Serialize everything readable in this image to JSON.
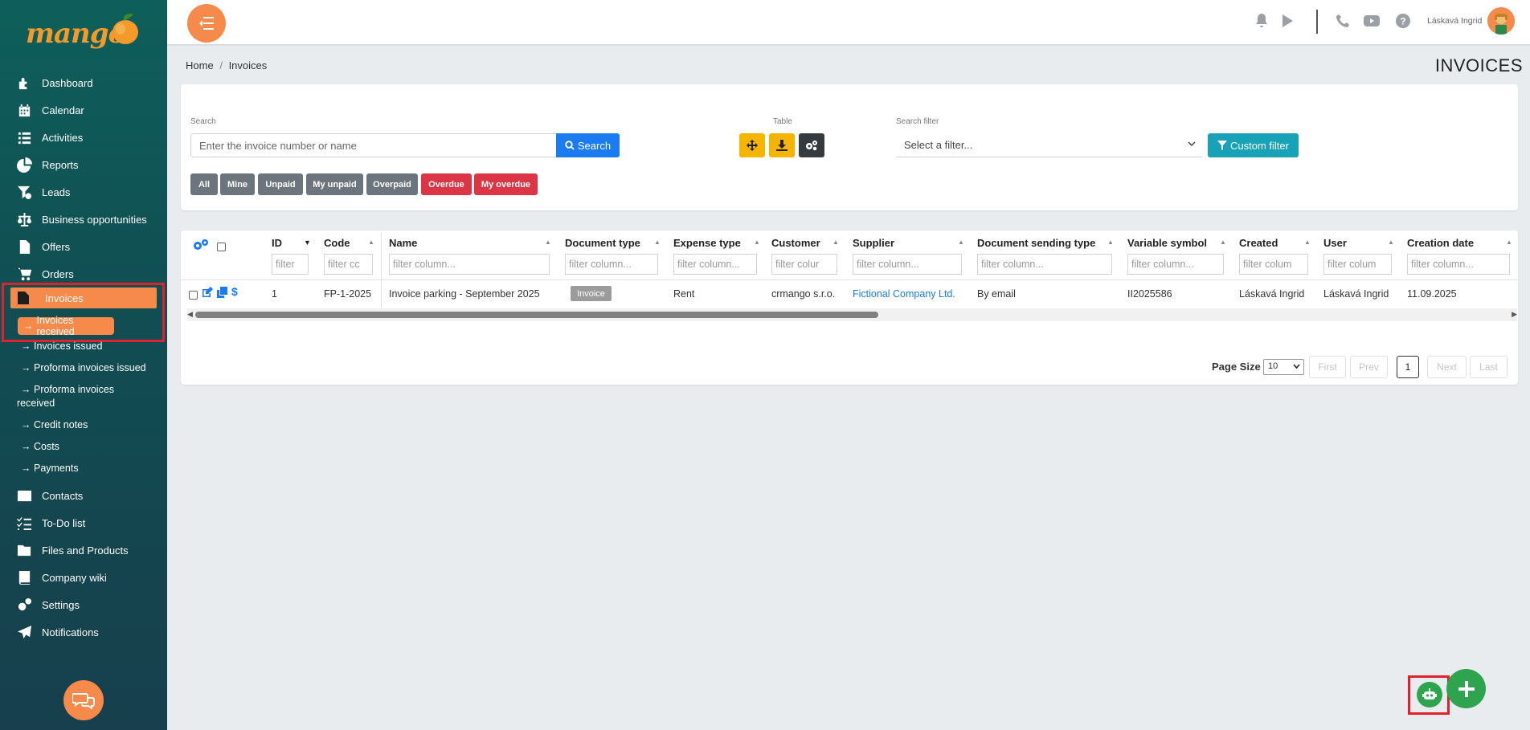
{
  "app": {
    "logo_text": "mango"
  },
  "sidebar": {
    "items": [
      {
        "label": "Dashboard",
        "icon": "puzzle-icon"
      },
      {
        "label": "Calendar",
        "icon": "calendar-icon"
      },
      {
        "label": "Activities",
        "icon": "list-icon"
      },
      {
        "label": "Reports",
        "icon": "pie-chart-icon"
      },
      {
        "label": "Leads",
        "icon": "funnel-dollar-icon"
      },
      {
        "label": "Business opportunities",
        "icon": "scales-icon"
      },
      {
        "label": "Offers",
        "icon": "file-icon"
      },
      {
        "label": "Orders",
        "icon": "cart-icon"
      }
    ],
    "invoices": {
      "label": "Invoices",
      "icon": "invoice-icon"
    },
    "sub_items": [
      {
        "label": "Invoices received",
        "active": true
      },
      {
        "label": "Invoices issued"
      },
      {
        "label": "Proforma invoices issued"
      },
      {
        "label": "Proforma invoices",
        "label2": "received"
      },
      {
        "label": "Credit notes"
      },
      {
        "label": "Costs"
      },
      {
        "label": "Payments"
      }
    ],
    "bottom_items": [
      {
        "label": "Contacts",
        "icon": "id-card-icon"
      },
      {
        "label": "To-Do list",
        "icon": "checklist-icon"
      },
      {
        "label": "Files and Products",
        "icon": "folder-icon"
      },
      {
        "label": "Company wiki",
        "icon": "book-icon"
      },
      {
        "label": "Settings",
        "icon": "gears-icon"
      },
      {
        "label": "Notifications",
        "icon": "paper-plane-icon"
      }
    ]
  },
  "topbar": {
    "username": "Láskavá Ingrid"
  },
  "breadcrumb": {
    "home": "Home",
    "separator": "/",
    "current": "Invoices"
  },
  "page_title": "INVOICES",
  "search": {
    "label": "Search",
    "placeholder": "Enter the invoice number or name",
    "button": "Search",
    "table_label": "Table",
    "filter_label": "Search filter",
    "filter_value": "Select a filter...",
    "custom_filter_button": "Custom filter"
  },
  "quick_filters": [
    "All",
    "Mine",
    "Unpaid",
    "My unpaid",
    "Overpaid",
    "Overdue",
    "My overdue"
  ],
  "table": {
    "columns": [
      "ID",
      "Code",
      "Name",
      "Document type",
      "Expense type",
      "Customer",
      "Supplier",
      "Document sending type",
      "Variable symbol",
      "Created",
      "User",
      "Creation date"
    ],
    "filter_placeholders": [
      "filter",
      "filter cc",
      "filter column...",
      "filter column...",
      "filter column...",
      "filter colur",
      "filter column...",
      "filter column...",
      "filter column...",
      "filter colum",
      "filter colum",
      "filter column..."
    ],
    "rows": [
      {
        "id": "1",
        "code": "FP-1-2025",
        "name": "Invoice parking - September 2025",
        "document_type": "Invoice",
        "expense_type": "Rent",
        "customer": "crmango s.r.o.",
        "supplier": "Fictional Company Ltd.",
        "sending_type": "By email",
        "variable_symbol": "II2025586",
        "created": "Láskavá Ingrid",
        "user": "Láskavá Ingrid",
        "creation_date": "11.09.2025"
      }
    ]
  },
  "pagination": {
    "page_size_label": "Page Size",
    "page_size": "10",
    "first": "First",
    "prev": "Prev",
    "current": "1",
    "next": "Next",
    "last": "Last"
  },
  "colors": {
    "accent": "#f58a4b",
    "sidebar": "#0e5f5b",
    "primary": "#1a7cf0",
    "info": "#17a2b8",
    "danger": "#dc3545",
    "warning": "#f5b400",
    "success": "#2ea44f",
    "highlight": "#e1212b"
  }
}
